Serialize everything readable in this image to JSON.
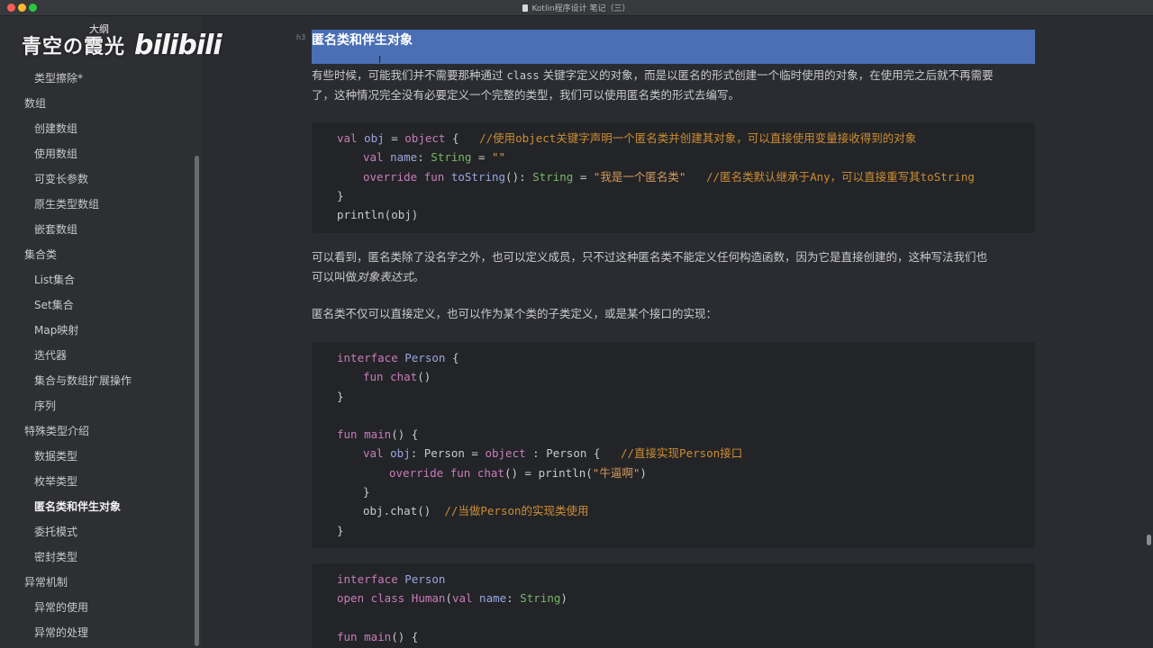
{
  "window": {
    "title": "Kotlin程序设计 笔记（三）"
  },
  "watermark": {
    "text": "青空の霞光",
    "sub": "大纲",
    "logo": "bilibili"
  },
  "sidebar": {
    "items": [
      {
        "label": "类型擦除*",
        "level": 2
      },
      {
        "label": "数组",
        "level": 1
      },
      {
        "label": "创建数组",
        "level": 2
      },
      {
        "label": "使用数组",
        "level": 2
      },
      {
        "label": "可变长参数",
        "level": 2
      },
      {
        "label": "原生类型数组",
        "level": 2
      },
      {
        "label": "嵌套数组",
        "level": 2
      },
      {
        "label": "集合类",
        "level": 1
      },
      {
        "label": "List集合",
        "level": 2
      },
      {
        "label": "Set集合",
        "level": 2
      },
      {
        "label": "Map映射",
        "level": 2
      },
      {
        "label": "迭代器",
        "level": 2
      },
      {
        "label": "集合与数组扩展操作",
        "level": 2
      },
      {
        "label": "序列",
        "level": 2
      },
      {
        "label": "特殊类型介绍",
        "level": 1
      },
      {
        "label": "数据类型",
        "level": 2
      },
      {
        "label": "枚举类型",
        "level": 2
      },
      {
        "label": "匿名类和伴生对象",
        "level": 2,
        "active": true
      },
      {
        "label": "委托模式",
        "level": 2
      },
      {
        "label": "密封类型",
        "level": 2
      },
      {
        "label": "异常机制",
        "level": 1
      },
      {
        "label": "异常的使用",
        "level": 2
      },
      {
        "label": "异常的处理",
        "level": 2
      }
    ]
  },
  "main": {
    "heading": "匿名类和伴生对象",
    "heading_marker": "h3",
    "para1_a": "有些时候，可能我们并不需要那种通过 ",
    "para1_code": "class",
    "para1_b": " 关键字定义的对象，而是以匿名的形式创建一个临时使用的对象，在使用完之后就不再需要",
    "para1_c": "了，这种情况完全没有必要定义一个完整的类型，我们可以使用匿名类的形式去编写。",
    "para2_a": "可以看到，匿名类除了没名字之外，也可以定义成员，只不过这种匿名类不能定义任何构造函数，因为它是直接创建的，这种写法我们也",
    "para2_b": "可以叫做",
    "para2_em": "对象表达式",
    "para2_c": "。",
    "para3": "匿名类不仅可以直接定义，也可以作为某个类的子类定义，或是某个接口的实现："
  },
  "code1": {
    "l1_kw": "val",
    "l1_var": " obj",
    "l1_a": " = ",
    "l1_kw2": "object",
    "l1_b": " {   ",
    "l1_cm": "//使用object关键字声明一个匿名类并创建其对象，可以直接使用变量接收得到的对象",
    "l2_kw": "val",
    "l2_var": " name",
    "l2_a": ": ",
    "l2_ty": "String",
    "l2_b": " = ",
    "l2_st": "\"\"",
    "l3_kw": "override fun",
    "l3_fn": " toString",
    "l3_a": "(): ",
    "l3_ty": "String",
    "l3_b": " = ",
    "l3_st": "\"我是一个匿名类\"",
    "l3_c": "   ",
    "l3_cm": "//匿名类默认继承于Any，可以直接重写其toString",
    "l4": "}",
    "l5": "println(obj)"
  },
  "code2": {
    "l1_kw": "interface",
    "l1_ty": " Person",
    "l1_a": " {",
    "l2_kw": "fun",
    "l2_fn": " chat",
    "l2_a": "()",
    "l3": "}",
    "l5_kw": "fun",
    "l5_fn": " main",
    "l5_a": "() {",
    "l6_kw": "val",
    "l6_var": " obj",
    "l6_a": ": Person = ",
    "l6_kw2": "object",
    "l6_b": " : Person {   ",
    "l6_cm": "//直接实现Person接口",
    "l7_kw": "override fun",
    "l7_fn": " chat",
    "l7_a": "() = println(",
    "l7_st": "\"牛逼啊\"",
    "l7_b": ")",
    "l8": "}",
    "l9_a": "obj.chat()  ",
    "l9_cm": "//当做Person的实现类使用",
    "l10": "}"
  },
  "code3": {
    "l1_kw": "interface",
    "l1_ty": " Person",
    "l2_kw": "open class",
    "l2_ty": " Human",
    "l2_a": "(",
    "l2_kw2": "val",
    "l2_var": " name",
    "l2_b": ": ",
    "l2_ty2": "String",
    "l2_c": ")",
    "l4_kw": "fun",
    "l4_fn": " main",
    "l4_a": "() {"
  },
  "colors": {
    "background": "#2b2c31",
    "sidebar": "#2e2f33",
    "selection": "#4a6fb5",
    "code_bg": "#232427",
    "keyword": "#c77dbb",
    "type": "#77b767",
    "string": "#d29a5e",
    "comment": "#cc8d34"
  }
}
